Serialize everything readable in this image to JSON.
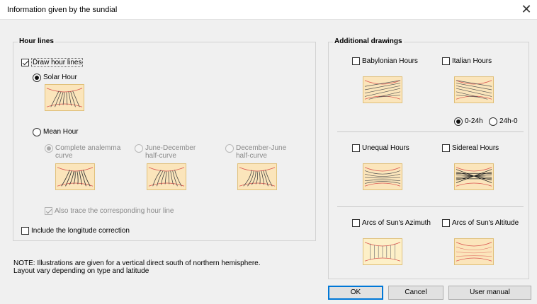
{
  "window": {
    "title": "Information given by the sundial",
    "close_glyph": "✕"
  },
  "hour_lines": {
    "title": "Hour lines",
    "draw_hour_lines": {
      "label": "Draw hour lines",
      "checked": true
    },
    "solar_hour": {
      "label": "Solar Hour",
      "selected": true
    },
    "mean_hour": {
      "label": "Mean Hour",
      "selected": false
    },
    "complete_analemma": {
      "line1": "Complete analemma",
      "line2": "curve",
      "selected": true,
      "enabled": false
    },
    "june_december": {
      "line1": "June-December",
      "line2": "half-curve",
      "selected": false,
      "enabled": false
    },
    "december_june": {
      "line1": "December-June",
      "line2": "half-curve",
      "selected": false,
      "enabled": false
    },
    "also_trace": {
      "label": "Also trace the corresponding hour line",
      "checked": true,
      "enabled": false
    },
    "longitude_correction": {
      "label": "Include the longitude correction",
      "checked": false
    }
  },
  "additional": {
    "title": "Additional drawings",
    "babylonian": {
      "label": "Babylonian Hours",
      "checked": false
    },
    "italian": {
      "label": "Italian Hours",
      "checked": false
    },
    "range_0_24": {
      "label": "0-24h",
      "selected": true
    },
    "range_24_0": {
      "label": "24h-0",
      "selected": false
    },
    "unequal": {
      "label": "Unequal Hours",
      "checked": false
    },
    "sidereal": {
      "label": "Sidereal Hours",
      "checked": false
    },
    "azimuth": {
      "label": "Arcs of Sun's Azimuth",
      "checked": false
    },
    "altitude": {
      "label": "Arcs of Sun's Altitude",
      "checked": false
    }
  },
  "note": {
    "line1": "NOTE: Illustrations are given for a vertical direct south of northern hemisphere.",
    "line2": "Layout vary depending on type and latitude"
  },
  "buttons": {
    "ok": "OK",
    "cancel": "Cancel",
    "user_manual": "User manual"
  },
  "colors": {
    "illustration_bg": "#fbe5bb",
    "curve_red": "#d9534f",
    "line_dark": "#333333",
    "accent": "#0078d7"
  }
}
